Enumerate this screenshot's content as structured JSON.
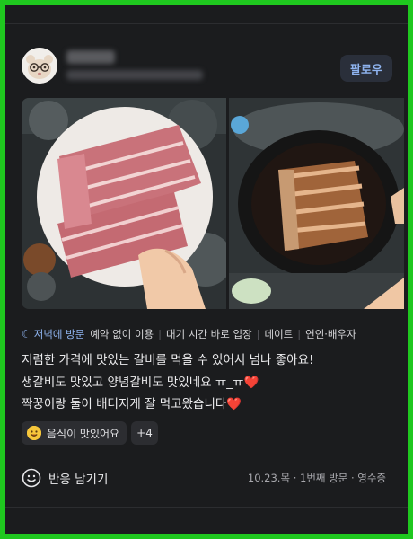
{
  "header": {
    "follow_label": "팔로우"
  },
  "tags": {
    "visit_time": "저녁에 방문",
    "reservation": "예약 없이 이용",
    "wait_time": "대기 시간 바로 입장",
    "purpose": "데이트",
    "companion": "연인·배우자"
  },
  "review": {
    "line1": "저렴한 가격에 맛있는 갈비를 먹을 수 있어서 넘나 좋아요!",
    "line2": "생갈비도 맛있고 양념갈비도 맛있네요 ㅠ_ㅠ",
    "line3": "짝꿍이랑 둘이 배터지게 잘 먹고왔습니다",
    "heart": "❤️"
  },
  "keywords": {
    "main": "음식이 맛있어요",
    "more": "+4"
  },
  "footer": {
    "react_label": "반응 남기기",
    "visit_info": "10.23.목 · 1번째 방문 · 영수증"
  },
  "colors": {
    "accent": "#8fb4f0",
    "frame": "#1fc81f",
    "background": "#1b1c1e",
    "heart": "#ee3a3a"
  }
}
